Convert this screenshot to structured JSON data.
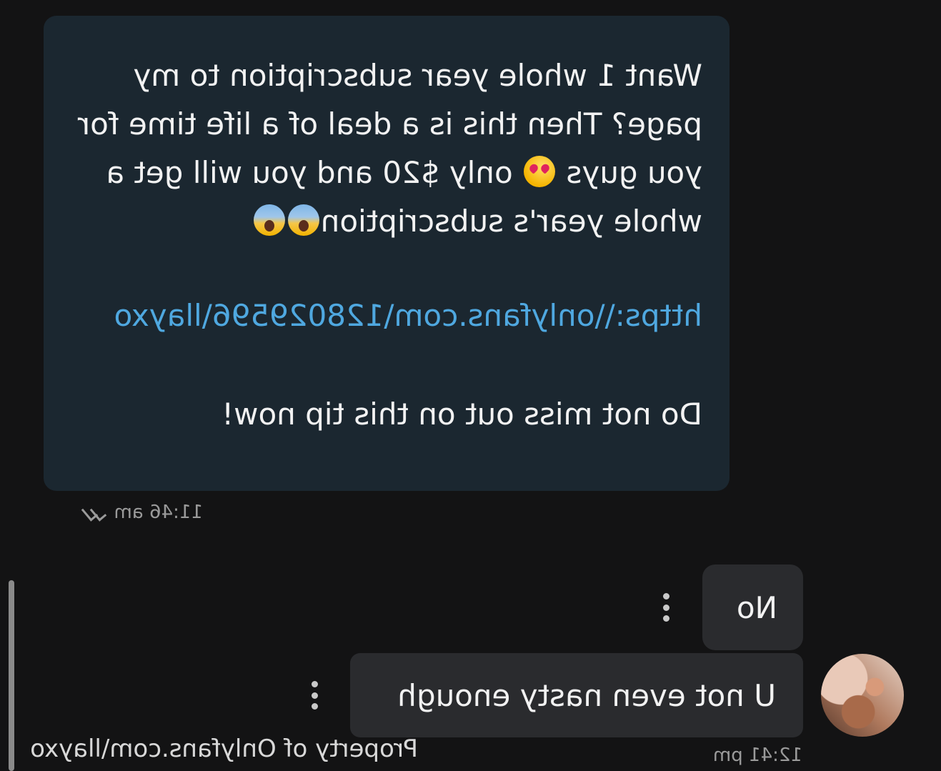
{
  "incoming_message": {
    "line1": "Want 1 whole year subscription to my page? Then this is a deal of a life time for you guys",
    "line1_after_emoji": "only $20 and you will get a whole year's subscription",
    "link": "https:\\\\onlyfans.com\\128029596\\llayxo",
    "closing": "Do not miss out on this tip now!",
    "time": "11:46 am",
    "emojis": [
      "heart-eyes-emoji",
      "screaming-face-emoji",
      "screaming-face-emoji"
    ]
  },
  "outgoing_messages": [
    {
      "text": "No"
    },
    {
      "text": "U not even nasty enough"
    }
  ],
  "outgoing_time": "12:41 pm",
  "watermark": "Property of Onlyfans.com\\llayxo",
  "colors": {
    "background": "#131314",
    "incoming_bubble": "#1b2730",
    "outgoing_bubble": "#2a2b2e",
    "link": "#4fa8e0"
  },
  "mirrored": true
}
